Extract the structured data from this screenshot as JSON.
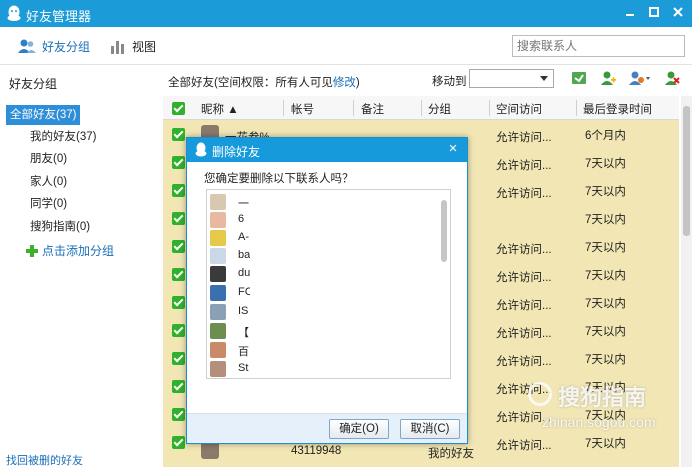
{
  "window": {
    "title": "好友管理器",
    "colors": {
      "titlebar": "#1b9bd7",
      "accent": "#1a6fb8",
      "selection": "#2f8ed8",
      "row_highlight": "#f1e6b4",
      "checkbox": "#2fb12b"
    }
  },
  "toolbar": {
    "friend_groups_label": "好友分组",
    "view_label": "视图",
    "search_placeholder": "搜索联系人"
  },
  "sidebar": {
    "heading": "好友分组",
    "groups": [
      {
        "label": "全部好友(37)"
      },
      {
        "label": "我的好友(37)"
      },
      {
        "label": "朋友(0)"
      },
      {
        "label": "家人(0)"
      },
      {
        "label": "同学(0)"
      },
      {
        "label": "搜狗指南(0)"
      }
    ],
    "add_group_label": "点击添加分组",
    "recover_label": "找回被删的好友"
  },
  "infobar": {
    "prefix": "全部好友(空间权限：所有人可见",
    "modify_link": "修改",
    "suffix": ")",
    "move_to_label": "移动到"
  },
  "table": {
    "columns": [
      "昵称 ▲",
      "帐号",
      "备注",
      "分组",
      "空间访问",
      "最后登录时间"
    ],
    "rows": [
      {
        "nickname": "一花叁%",
        "account": "",
        "note": "",
        "group": "",
        "access": "允许访问...",
        "last_login": "6个月内"
      },
      {
        "nickname": "",
        "account": "",
        "note": "",
        "group": "",
        "access": "允许访问...",
        "last_login": "7天以内"
      },
      {
        "nickname": "",
        "account": "",
        "note": "",
        "group": "",
        "access": "允许访问...",
        "last_login": "7天以内"
      },
      {
        "nickname": "",
        "account": "",
        "note": "",
        "group": "",
        "access": "",
        "last_login": "7天以内"
      },
      {
        "nickname": "",
        "account": "",
        "note": "",
        "group": "",
        "access": "允许访问...",
        "last_login": "7天以内"
      },
      {
        "nickname": "",
        "account": "",
        "note": "",
        "group": "",
        "access": "允许访问...",
        "last_login": "7天以内"
      },
      {
        "nickname": "",
        "account": "",
        "note": "",
        "group": "",
        "access": "允许访问...",
        "last_login": "7天以内"
      },
      {
        "nickname": "",
        "account": "",
        "note": "",
        "group": "",
        "access": "允许访问...",
        "last_login": "7天以内"
      },
      {
        "nickname": "",
        "account": "",
        "note": "",
        "group": "",
        "access": "允许访问...",
        "last_login": "7天以内"
      },
      {
        "nickname": "",
        "account": "",
        "note": "",
        "group": "",
        "access": "允许访问...",
        "last_login": "7天以内"
      },
      {
        "nickname": "",
        "account": "",
        "note": "",
        "group": "",
        "access": "允许访问...",
        "last_login": "7天以内"
      },
      {
        "nickname": "",
        "account": "",
        "note": "",
        "group": "",
        "access": "允许访问...",
        "last_login": "7天以内"
      },
      {
        "nickname": "",
        "account": "43119948",
        "note": "",
        "group": "我的好友",
        "access": "允许访问...",
        "last_login": "7天以内"
      }
    ]
  },
  "dialog": {
    "title": "删除好友",
    "close_symbol": "×",
    "question": "您确定要删除以下联系人吗？",
    "contacts": [
      {
        "name": "一",
        "color": "#d9c7b0"
      },
      {
        "name": "6",
        "color": "#e8b9a0"
      },
      {
        "name": "A-",
        "color": "#e6c84a"
      },
      {
        "name": "ba",
        "color": "#c9d7e6"
      },
      {
        "name": "du",
        "color": "#3a3a3a"
      },
      {
        "name": "FC",
        "color": "#3a6fb0"
      },
      {
        "name": "IS",
        "color": "#8aa0b4"
      },
      {
        "name": "【",
        "color": "#6b8f4e"
      },
      {
        "name": "百",
        "color": "#c98a6a"
      },
      {
        "name": "St",
        "color": "#b58f7e"
      }
    ],
    "ok_label": "确定(O)",
    "cancel_label": "取消(C)"
  },
  "watermark": {
    "text": "搜狗指南",
    "url": "zhinan.sogou.com"
  }
}
